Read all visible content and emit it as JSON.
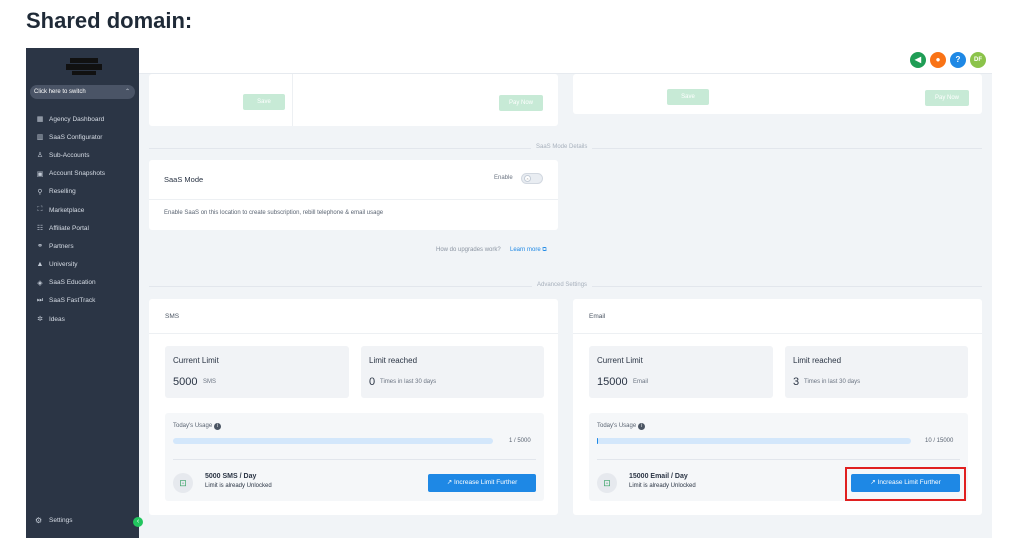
{
  "heading": "Shared domain:",
  "sidebar": {
    "switcher": "Click here to switch",
    "items": [
      {
        "label": "Agency Dashboard",
        "icon": "building-icon"
      },
      {
        "label": "SaaS Configurator",
        "icon": "chart-icon"
      },
      {
        "label": "Sub-Accounts",
        "icon": "person-icon"
      },
      {
        "label": "Account Snapshots",
        "icon": "snapshot-icon"
      },
      {
        "label": "Reselling",
        "icon": "reselling-icon"
      },
      {
        "label": "Marketplace",
        "icon": "bag-icon"
      },
      {
        "label": "Affiliate Portal",
        "icon": "people-icon"
      },
      {
        "label": "Partners",
        "icon": "handshake-icon"
      },
      {
        "label": "University",
        "icon": "cap-icon"
      },
      {
        "label": "SaaS Education",
        "icon": "cube-icon"
      },
      {
        "label": "SaaS FastTrack",
        "icon": "fast-forward-icon"
      },
      {
        "label": "Ideas",
        "icon": "bulb-icon"
      }
    ],
    "settings": "Settings"
  },
  "topbar": {
    "icons": [
      {
        "name": "megaphone-icon",
        "color": "#1f9d55",
        "glyph": "📢"
      },
      {
        "name": "bell-icon",
        "color": "#f97316",
        "glyph": "🔔"
      },
      {
        "name": "help-icon",
        "color": "#1e88e5",
        "glyph": "?"
      },
      {
        "name": "avatar",
        "color": "#8bc34a",
        "glyph": "DF"
      }
    ]
  },
  "top_cards": {
    "save_label": "Save",
    "pay_now_label": "Pay Now"
  },
  "saas_mode": {
    "section_label": "SaaS Mode Details",
    "title": "SaaS Mode",
    "enable_label": "Enable",
    "description": "Enable SaaS on this location to create subscription, rebill telephone & email usage",
    "upgrade_question": "How do upgrades work?",
    "learn_more": "Learn more"
  },
  "advanced": {
    "section_label": "Advanced Settings",
    "sms": {
      "title": "SMS",
      "current_limit_label": "Current Limit",
      "current_limit_value": "5000",
      "current_limit_unit": "SMS",
      "limit_reached_label": "Limit reached",
      "limit_reached_value": "0",
      "limit_reached_unit": "Times in last 30 days",
      "todays_usage_label": "Today's Usage",
      "usage_text": "1 / 5000",
      "usage_fraction": 0.0002,
      "per_day": "5000 SMS / Day",
      "unlocked_text": "Limit is already Unlocked",
      "button": "Increase Limit Further"
    },
    "email": {
      "title": "Email",
      "current_limit_label": "Current Limit",
      "current_limit_value": "15000",
      "current_limit_unit": "Email",
      "limit_reached_label": "Limit reached",
      "limit_reached_value": "3",
      "limit_reached_unit": "Times in last 30 days",
      "todays_usage_label": "Today's Usage",
      "usage_text": "10 / 15000",
      "usage_fraction": 0.0007,
      "per_day": "15000 Email / Day",
      "unlocked_text": "Limit is already Unlocked",
      "button": "Increase Limit Further"
    }
  },
  "colors": {
    "sidebar_bg": "#2b3545",
    "primary_blue": "#1e88e5",
    "highlight_red": "#e02020",
    "save_green_disabled": "#c7ead6"
  }
}
